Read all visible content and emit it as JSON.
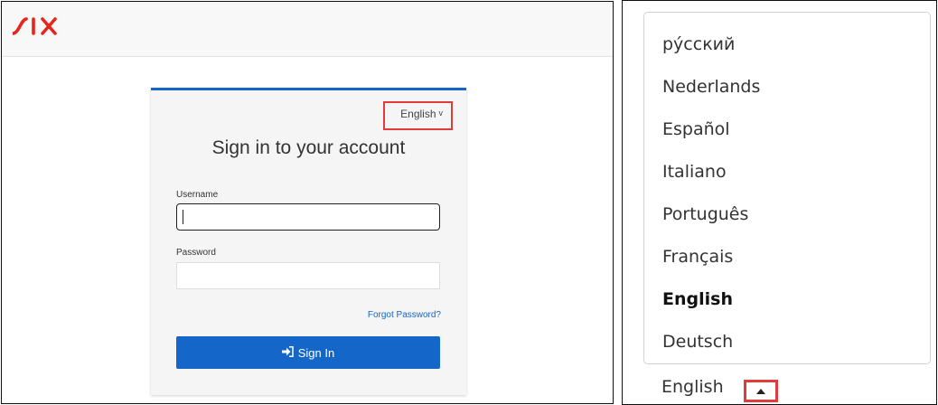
{
  "login": {
    "language_label": "English",
    "title": "Sign in to your account",
    "username_label": "Username",
    "username_value": "",
    "password_label": "Password",
    "password_value": "",
    "forgot_password": "Forgot Password?",
    "sign_in": "Sign In"
  },
  "language_menu": {
    "options": [
      "рýсский",
      "Nederlands",
      "Español",
      "Italiano",
      "Português",
      "Français",
      "English",
      "Deutsch"
    ],
    "selected": "English",
    "current": "English"
  },
  "colors": {
    "brand": "#e4261c",
    "primary": "#1466c8",
    "highlight": "#e23b3b"
  },
  "icons": {
    "logo": "six-logo",
    "sign_in": "sign-in-icon",
    "chevron": "chevron-down-icon",
    "caret": "caret-up-icon"
  }
}
